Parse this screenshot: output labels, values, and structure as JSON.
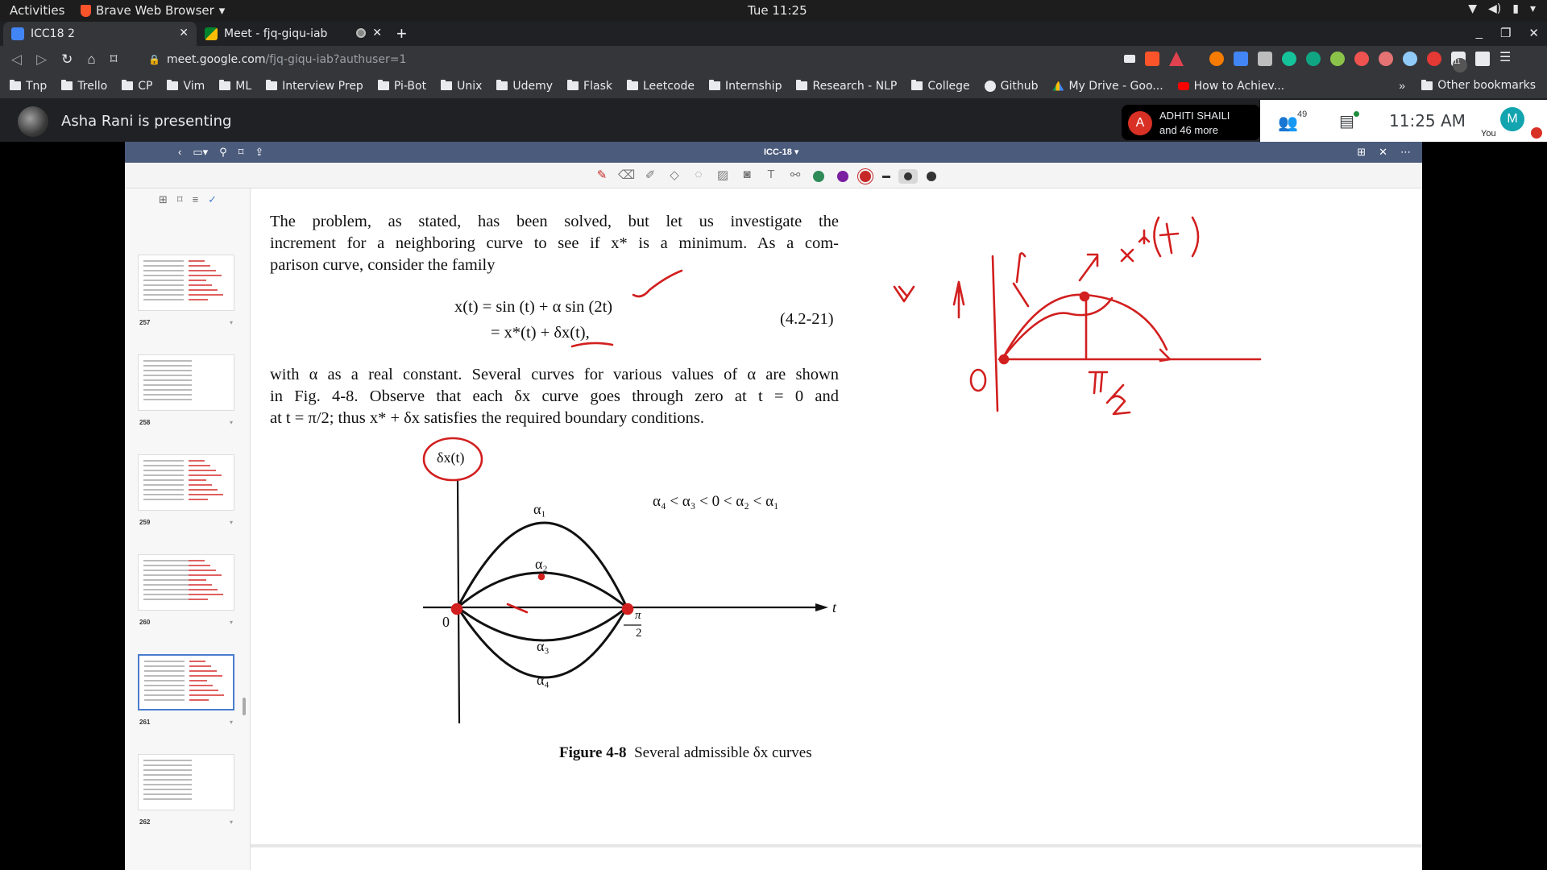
{
  "system": {
    "activities": "Activities",
    "app_name": "Brave Web Browser",
    "clock": "Tue 11:25"
  },
  "tabs": [
    {
      "title": "ICC18 2"
    },
    {
      "title": "Meet - fjq-giqu-iab"
    }
  ],
  "address": {
    "host": "meet.google.com",
    "path": "/fjq-giqu-iab?authuser=1"
  },
  "bookmarks": [
    "Tnp",
    "Trello",
    "CP",
    "Vim",
    "ML",
    "Interview Prep",
    "Pi-Bot",
    "Unix",
    "Udemy",
    "Flask",
    "Leetcode",
    "Internship",
    "Research - NLP",
    "College",
    "Github",
    "My Drive - Goo...",
    "How to Achiev..."
  ],
  "other_bookmarks": "Other bookmarks",
  "bookmarks_more": "»",
  "extension_badge": "11",
  "meet": {
    "presenting": "Asha Rani is presenting",
    "participant_initial": "A",
    "participant_name": "ADHITI SHAILI",
    "participant_more": "and 46 more",
    "people_count": "49",
    "time": "11:25  AM",
    "self_initial": "M",
    "self_label": "You"
  },
  "viewer": {
    "title": "ICC-18",
    "thumbnails": [
      "257",
      "258",
      "259",
      "260",
      "261",
      "262"
    ],
    "pen_colors": [
      "#2e8b57",
      "#7b1fa2",
      "#c62828"
    ]
  },
  "page": {
    "para1": [
      "The problem, as stated, has been solved, but let us investigate the",
      "increment for a neighboring curve to see if x* is a minimum. As a com-",
      "parison curve, consider the family"
    ],
    "eq_line1": "x(t) = sin (t) + α sin (2t)",
    "eq_line2": "= x*(t) + δx(t),",
    "eq_number": "(4.2-21)",
    "para2": [
      "with α as a real constant. Several curves for various values of α are shown",
      "in Fig. 4-8. Observe that each δx curve goes through zero at t = 0 and",
      "at t = π/2; thus x* + δx satisfies the required boundary conditions."
    ],
    "fig_ylabel": "δx(t)",
    "fig_order": "α₄ < α₃ < 0 < α₂ < α₁",
    "fig_alpha1": "α₁",
    "fig_alpha2": "α₂",
    "fig_alpha3": "α₃",
    "fig_alpha4": "α₄",
    "fig_origin": "0",
    "fig_t": "t",
    "fig_pi": "π",
    "fig_two": "2",
    "caption_bold": "Figure 4-8",
    "caption_text": "Several admissible δx curves"
  }
}
